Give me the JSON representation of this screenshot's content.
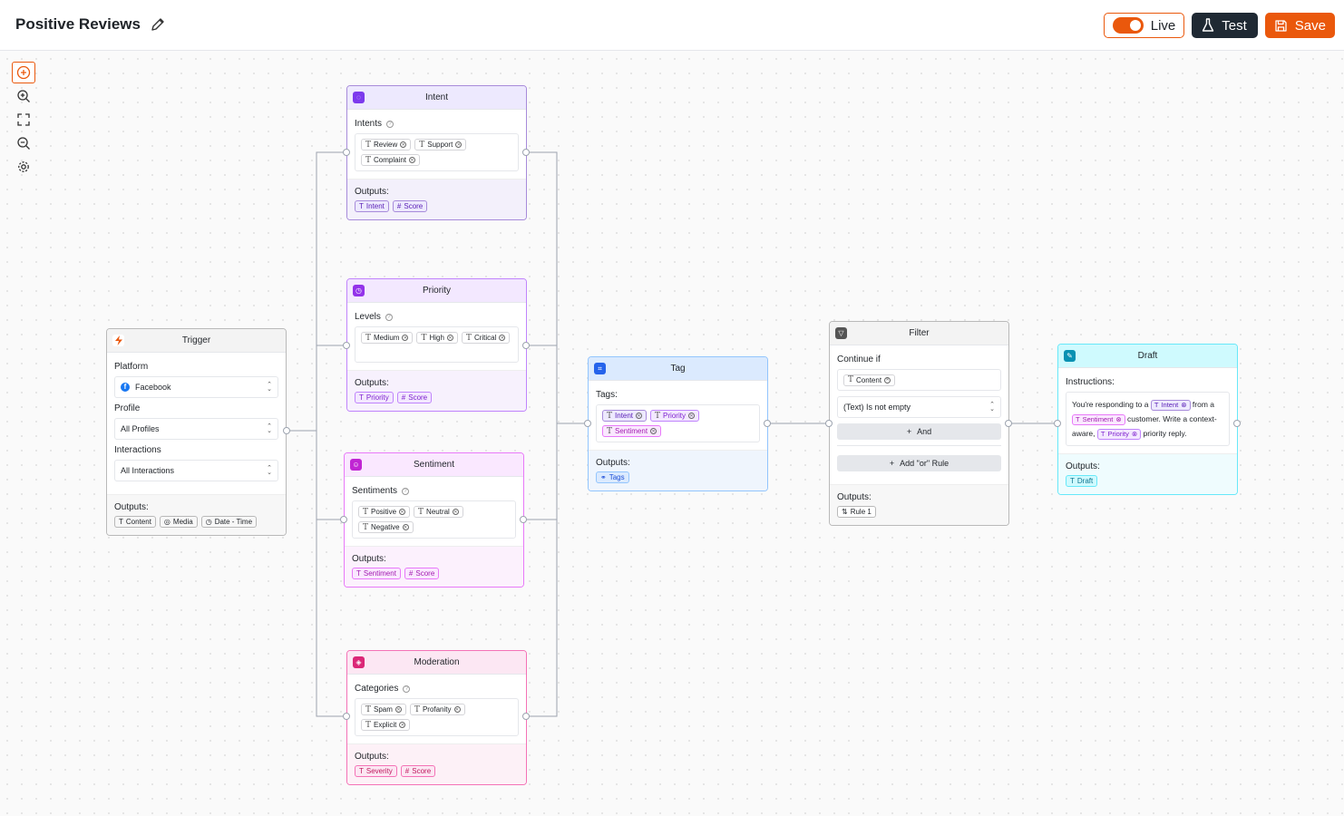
{
  "header": {
    "title": "Positive Reviews",
    "live_label": "Live",
    "test_label": "Test",
    "save_label": "Save"
  },
  "colors": {
    "accent": "#ea580c",
    "dark": "#1f2933"
  },
  "toolbar": {
    "tools": [
      "add-node-icon",
      "zoom-in-icon",
      "fit-view-icon",
      "zoom-out-icon",
      "settings-icon"
    ]
  },
  "nodes": {
    "trigger": {
      "title": "Trigger",
      "platform_label": "Platform",
      "platform_value": "Facebook",
      "profile_label": "Profile",
      "profile_value": "All Profiles",
      "interactions_label": "Interactions",
      "interactions_value": "All Interactions",
      "outputs_label": "Outputs:",
      "outputs": [
        "Content",
        "Media",
        "Date - Time"
      ]
    },
    "intent": {
      "title": "Intent",
      "field_label": "Intents",
      "chips": [
        "Review",
        "Support",
        "Complaint"
      ],
      "outputs_label": "Outputs:",
      "outputs": [
        "Intent",
        "Score"
      ]
    },
    "priority": {
      "title": "Priority",
      "field_label": "Levels",
      "chips": [
        "Medium",
        "High",
        "Critical"
      ],
      "outputs_label": "Outputs:",
      "outputs": [
        "Priority",
        "Score"
      ]
    },
    "sentiment": {
      "title": "Sentiment",
      "field_label": "Sentiments",
      "chips": [
        "Positive",
        "Neutral",
        "Negative"
      ],
      "outputs_label": "Outputs:",
      "outputs": [
        "Sentiment",
        "Score"
      ]
    },
    "moderation": {
      "title": "Moderation",
      "field_label": "Categories",
      "chips": [
        "Spam",
        "Profanity",
        "Explicit"
      ],
      "outputs_label": "Outputs:",
      "outputs": [
        "Severity",
        "Score"
      ]
    },
    "tag": {
      "title": "Tag",
      "field_label": "Tags:",
      "chips": [
        "Intent",
        "Priority",
        "Sentiment"
      ],
      "outputs_label": "Outputs:",
      "outputs": [
        "Tags"
      ]
    },
    "filter": {
      "title": "Filter",
      "field_label": "Continue if",
      "chip": "Content",
      "condition": "(Text) Is not empty",
      "and_label": "And",
      "or_label": "Add \"or\" Rule",
      "outputs_label": "Outputs:",
      "outputs": [
        "Rule 1"
      ]
    },
    "draft": {
      "title": "Draft",
      "field_label": "Instructions:",
      "text_1": "You're responding to a",
      "chip_1": "Intent",
      "text_2": "from a",
      "chip_2": "Sentiment",
      "text_3": "customer.",
      "text_4": "Write a context-aware,",
      "chip_3": "Priority",
      "text_5": "priority reply.",
      "outputs_label": "Outputs:",
      "outputs": [
        "Draft"
      ]
    }
  }
}
